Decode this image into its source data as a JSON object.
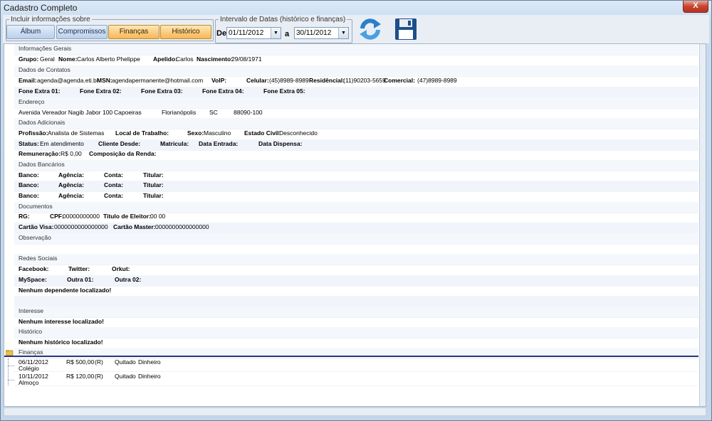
{
  "window": {
    "title": "Cadastro Completo",
    "close": "X"
  },
  "toolbar": {
    "include_legend": "Incluir informações sobre",
    "buttons": [
      {
        "label": "Álbum",
        "active": false
      },
      {
        "label": "Compromissos",
        "active": false
      },
      {
        "label": "Finanças",
        "active": true
      },
      {
        "label": "Histórico",
        "active": true
      }
    ],
    "date_legend": "Intervalo de Datas (histórico e finanças)",
    "de_label": "De",
    "a_label": "a",
    "date_from": "01/11/2012",
    "date_to": "30/11/2012",
    "combo_arrow": "▼"
  },
  "sections": {
    "gerais": "Informações Gerais",
    "contatos": "Dados de Contatos",
    "endereco": "Endereço",
    "adicionais": "Dados Adicionais",
    "bancarios": "Dados Bancários",
    "documentos": "Documentos",
    "observacao": "Observação",
    "redes": "Redes Sociais",
    "interesse": "Interesse",
    "historico": "Histórico",
    "financas": "Finanças"
  },
  "gerais": {
    "grupo_l": "Grupo:",
    "grupo": "Geral",
    "nome_l": "Nome:",
    "nome": "Carlos Alberto Phelippe",
    "apelido_l": "Apelido:",
    "apelido": "Carlos",
    "nasc_l": "Nascimento:",
    "nasc": "29/08/1971"
  },
  "contatos": {
    "email_l": "Email:",
    "email": "agenda@agenda.eti.br",
    "msn_l": "MSN:",
    "msn": "agendapermanente@hotmail.com",
    "voip_l": "VoIP:",
    "cel_l": "Celular:",
    "cel": "(45)8989-8989",
    "res_l": "Residêncial:",
    "res": "(11)90203-5659",
    "com_l": "Comercial:",
    "com": "(47)8989-8989",
    "fe1": "Fone Extra 01:",
    "fe2": "Fone Extra 02:",
    "fe3": "Fone Extra 03:",
    "fe4": "Fone Extra 04:",
    "fe5": "Fone Extra 05:"
  },
  "endereco": {
    "rua": "Avenida Vereador Nagib Jabor 100",
    "bairro": "Capoeiras",
    "cidade": "Florianópolis",
    "uf": "SC",
    "cep": "88090-100"
  },
  "adicionais": {
    "prof_l": "Profissão:",
    "prof": "Analista de Sistemas",
    "local_l": "Local de Trabalho:",
    "sexo_l": "Sexo:",
    "sexo": "Masculino",
    "civil_l": "Estado Civil:",
    "civil": "Desconhecido",
    "status_l": "Status:",
    "status": "Em atendimento",
    "cliente_l": "Cliente Desde:",
    "matricula_l": "Matricula:",
    "entrada_l": "Data Entrada:",
    "dispensa_l": "Data Dispensa:",
    "remun_l": "Remuneração:",
    "remun": "R$ 0,00",
    "comp_l": "Composição da Renda:"
  },
  "banco": {
    "banco_l": "Banco:",
    "agencia_l": "Agência:",
    "conta_l": "Conta:",
    "titular_l": "Titular:"
  },
  "documentos": {
    "rg_l": "RG:",
    "cpf_l": "CPF:",
    "cpf": "00000000000",
    "titulo_l": "Titulo de Eleitor:",
    "titulo": "00 00",
    "visa_l": "Cartão Visa:",
    "visa": "0000000000000000",
    "master_l": "Cartão Master:",
    "master": "0000000000000000"
  },
  "redes": {
    "facebook_l": "Facebook:",
    "twitter_l": "Twitter:",
    "orkut_l": "Orkut:",
    "myspace_l": "MySpace:",
    "outra1_l": "Outra 01:",
    "outra2_l": "Outra 02:"
  },
  "messages": {
    "dependente": "Nenhum dependente localizado!",
    "interesse": "Nenhum interesse localizado!",
    "historico": "Nenhum histórico localizado!"
  },
  "financas": [
    {
      "date": "06/11/2012",
      "desc": "Colégio",
      "value": "R$ 500,00",
      "type": "(R)",
      "status": "Quitado",
      "method": "Dinheiro"
    },
    {
      "date": "10/11/2012",
      "desc": "Almoço",
      "value": "R$ 120,00",
      "type": "(R)",
      "status": "Quitado",
      "method": "Dinheiro"
    }
  ]
}
